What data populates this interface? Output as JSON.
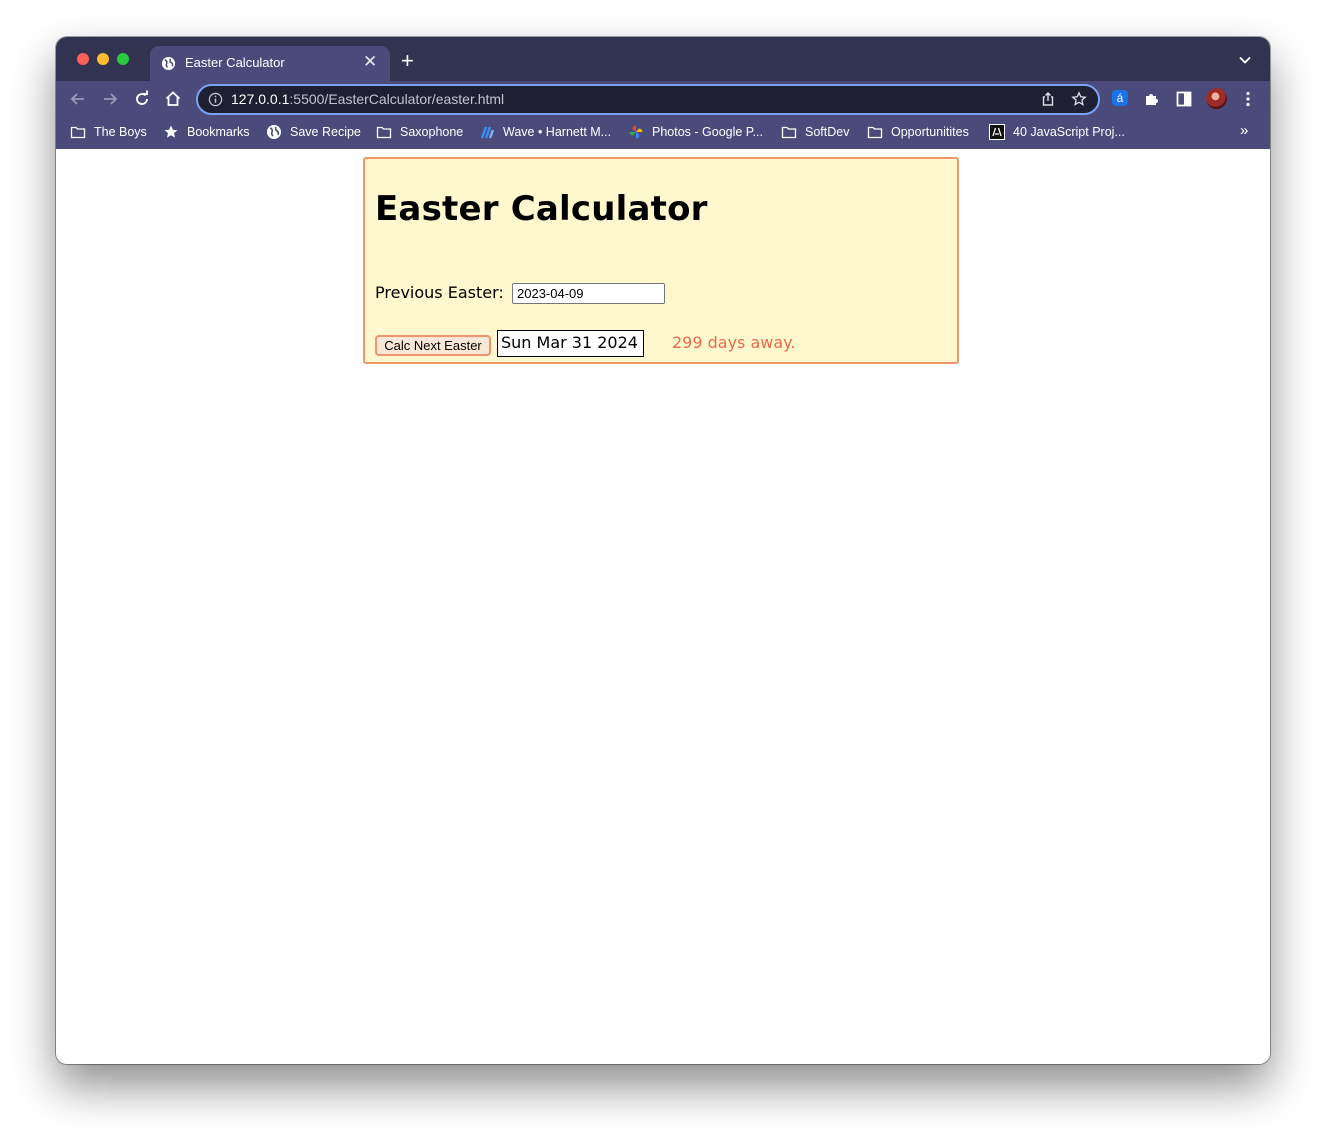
{
  "browser": {
    "tab": {
      "title": "Easter Calculator",
      "close_glyph": "✕"
    },
    "new_tab_glyph": "+",
    "address": {
      "host": "127.0.0.1",
      "rest": ":5500/EasterCalculator/easter.html"
    },
    "extension_letter": "á",
    "bookmarks": [
      {
        "label": "The Boys",
        "icon": "folder-icon"
      },
      {
        "label": "Bookmarks",
        "icon": "star-icon"
      },
      {
        "label": "Save Recipe",
        "icon": "globe-icon"
      },
      {
        "label": "Saxophone",
        "icon": "folder-icon"
      },
      {
        "label": "Wave • Harnett M...",
        "icon": "wave-icon"
      },
      {
        "label": "Photos - Google P...",
        "icon": "pinwheel-icon"
      },
      {
        "label": "SoftDev",
        "icon": "folder-icon"
      },
      {
        "label": "Opportunitites",
        "icon": "folder-icon"
      },
      {
        "label": "40 JavaScript Proj...",
        "icon": "js-icon"
      }
    ],
    "more_glyph": "»"
  },
  "page": {
    "heading": "Easter Calculator",
    "previous_label": "Previous Easter:",
    "previous_value": "2023-04-09",
    "button_label": "Calc Next Easter",
    "result": "Sun Mar 31 2024",
    "days_away": "299 days away."
  },
  "colors": {
    "card_background": "#fff8cf",
    "card_border": "#f0946c",
    "days_away_text": "#e76b4c",
    "chrome_frame": "#4a4b7a"
  }
}
